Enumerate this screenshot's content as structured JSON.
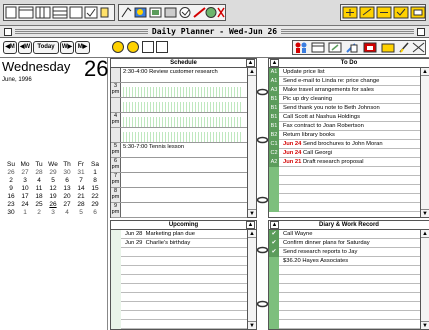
{
  "window": {
    "title": "Daily Planner - Wed-Jun 26"
  },
  "nav": {
    "prev_month": "◀M",
    "prev_week": "◀W",
    "today": "Today",
    "next_week": "W▶",
    "next_month": "M▶"
  },
  "date": {
    "weekday_day": "Wednesday",
    "day_number": "26",
    "month_year": "June, 1996"
  },
  "calendar": {
    "headers": [
      "Su",
      "Mo",
      "Tu",
      "We",
      "Th",
      "Fr",
      "Sa"
    ],
    "weeks": [
      [
        "26",
        "27",
        "28",
        "29",
        "30",
        "31",
        "1"
      ],
      [
        "2",
        "3",
        "4",
        "5",
        "6",
        "7",
        "8"
      ],
      [
        "9",
        "10",
        "11",
        "12",
        "13",
        "14",
        "15"
      ],
      [
        "16",
        "17",
        "18",
        "19",
        "20",
        "21",
        "22"
      ],
      [
        "23",
        "24",
        "25",
        "26",
        "27",
        "28",
        "29"
      ],
      [
        "30",
        "1",
        "2",
        "3",
        "4",
        "5",
        "6"
      ]
    ],
    "today": "26"
  },
  "schedule": {
    "title": "Schedule",
    "rows": [
      {
        "hour": "",
        "text": "2:30-4:00 Review customer research"
      },
      {
        "hour": "3\npm",
        "text": ""
      },
      {
        "hour": "",
        "text": ""
      },
      {
        "hour": "4\npm",
        "text": ""
      },
      {
        "hour": "",
        "text": ""
      },
      {
        "hour": "5\npm",
        "text": "5:30-7:00 Tennis lesson"
      },
      {
        "hour": "6\npm",
        "text": ""
      },
      {
        "hour": "7\npm",
        "text": ""
      },
      {
        "hour": "8\npm",
        "text": ""
      },
      {
        "hour": "9\npm",
        "text": ""
      }
    ]
  },
  "todo": {
    "title": "To Do",
    "items": [
      {
        "priority": "A1",
        "date": "",
        "text": "Update price list"
      },
      {
        "priority": "A1",
        "date": "",
        "text": "Send e-mail to Linda re: price change"
      },
      {
        "priority": "A3",
        "date": "",
        "text": "Make travel arrangements for sales"
      },
      {
        "priority": "B1",
        "date": "",
        "text": "Pic up dry cleaning"
      },
      {
        "priority": "B1",
        "date": "",
        "text": "Send thank you note to Beth Johnson"
      },
      {
        "priority": "B1",
        "date": "",
        "text": "Call Scott at Nashua Holdings"
      },
      {
        "priority": "B1",
        "date": "",
        "text": "Fax contract to Joan Robertson"
      },
      {
        "priority": "B2",
        "date": "",
        "text": "Return library books"
      },
      {
        "priority": "C1",
        "date": "Jun 24",
        "text": "Send brochures to John Moran"
      },
      {
        "priority": "C2",
        "date": "Jun 24",
        "text": "Call Georgi"
      },
      {
        "priority": "A2",
        "date": "Jun 21",
        "text": "Draft research proposal"
      },
      {
        "priority": "",
        "date": "",
        "text": ""
      },
      {
        "priority": "",
        "date": "",
        "text": ""
      },
      {
        "priority": "",
        "date": "",
        "text": ""
      },
      {
        "priority": "",
        "date": "",
        "text": ""
      },
      {
        "priority": "",
        "date": "",
        "text": ""
      }
    ]
  },
  "upcoming": {
    "title": "Upcoming",
    "items": [
      {
        "text": "Jun 28  Marketing plan due"
      },
      {
        "text": "Jun 29  Charlie's birthday"
      }
    ]
  },
  "diary": {
    "title": "Diary & Work Record",
    "items": [
      {
        "check": "✔",
        "text": "Call Wayne"
      },
      {
        "check": "✔",
        "text": "Confirm dinner plans for Saturday"
      },
      {
        "check": "✔",
        "text": "Send research reports to Jay"
      },
      {
        "check": "",
        "text": "$36.20 Hayes Associates"
      }
    ]
  },
  "colors": {
    "accent_green": "#5b9c5b",
    "hilite_red": "#d40000",
    "toolbar_bg": "#dcdcdc"
  }
}
